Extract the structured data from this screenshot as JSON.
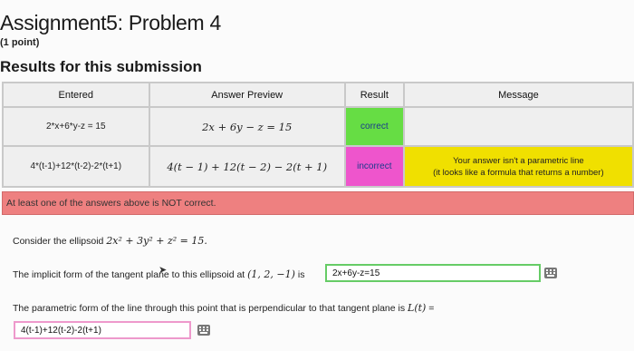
{
  "page": {
    "title": "Assignment5: Problem 4",
    "points": "(1 point)",
    "results_heading": "Results for this submission"
  },
  "results_table": {
    "headers": [
      "Entered",
      "Answer Preview",
      "Result",
      "Message"
    ],
    "rows": [
      {
        "entered": "2*x+6*y-z = 15",
        "preview": "2x + 6y − z = 15",
        "result": "correct",
        "message_line1": "",
        "message_line2": ""
      },
      {
        "entered": "4*(t-1)+12*(t-2)-2*(t+1)",
        "preview": "4(t − 1) + 12(t − 2) − 2(t + 1)",
        "result": "incorrect",
        "message_line1": "Your answer isn't a parametric line",
        "message_line2": "(it looks like a formula that returns a number)"
      }
    ]
  },
  "alert": {
    "text": "At least one of the answers above is NOT correct."
  },
  "problem": {
    "intro_prefix": "Consider the ellipsoid ",
    "intro_math": "2x² + 3y² + z² = 15.",
    "q1_prefix": "The implicit form of the tangent plane to this ellipsoid at ",
    "q1_math": "(1, 2, −1)",
    "q1_suffix": " is",
    "q1_answer": "2x+6y-z=15",
    "q2_prefix": "The parametric form of the line through this point that is perpendicular to that tangent plane is ",
    "q2_math": "L(t)",
    "q2_suffix": " =",
    "q2_answer": "4(t-1)+12(t-2)-2(t+1)"
  },
  "colors": {
    "correct": "#66dd44",
    "incorrect": "#ee55cc",
    "message": "#f0e000",
    "alert": "#ee8080"
  },
  "icons": [
    "keyboard-icon",
    "mouse-cursor-icon"
  ]
}
